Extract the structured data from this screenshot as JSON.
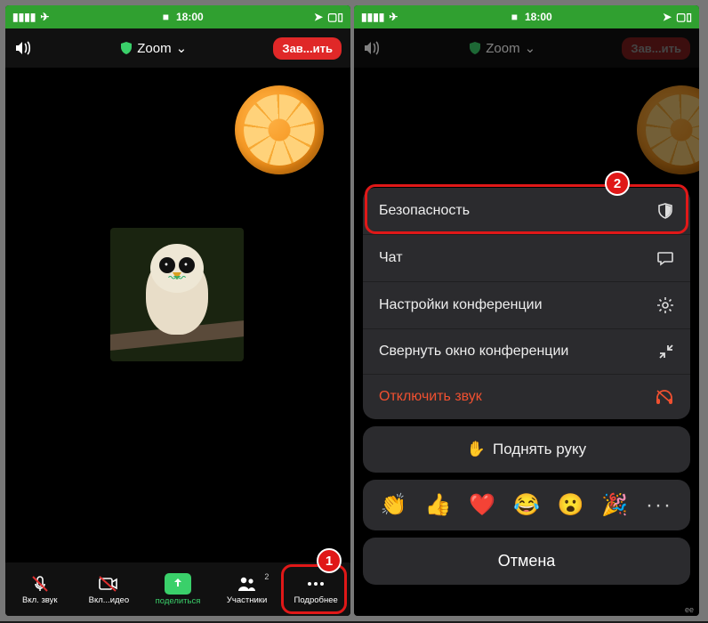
{
  "statusbar": {
    "time": "18:00",
    "camera_indicator": "●"
  },
  "header": {
    "title": "Zoom",
    "end_label": "Зав...ить"
  },
  "toolbar_left": {
    "mute": "Вкл. звук",
    "video": "Вкл...идео",
    "share": "поделиться",
    "participants": "Участники",
    "participants_count": "2",
    "more": "Подробнее"
  },
  "markers": {
    "one": "1",
    "two": "2"
  },
  "menu": {
    "security": "Безопасность",
    "chat": "Чат",
    "settings": "Настройки конференции",
    "minimize": "Свернуть окно конференции",
    "disconnect_audio": "Отключить звук",
    "raise_hand": "Поднять руку",
    "cancel": "Отмена"
  },
  "reactions": [
    "👏",
    "👍",
    "❤️",
    "😂",
    "😮",
    "🎉",
    "···"
  ],
  "peek_right": "ее"
}
